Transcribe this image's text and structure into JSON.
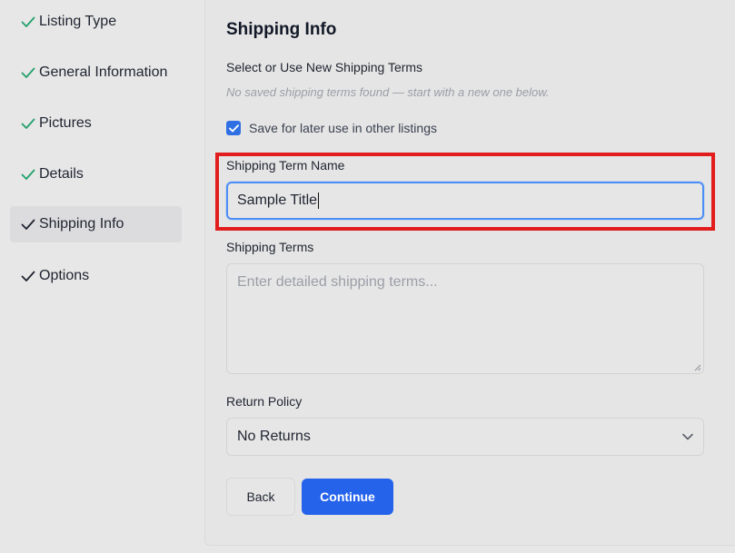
{
  "colors": {
    "accent": "#2563eb",
    "completed_check": "#22a06b",
    "highlight_box": "#e11d1d"
  },
  "sidebar": {
    "steps": [
      {
        "label": "Listing Type",
        "status": "completed",
        "icon": "check-icon"
      },
      {
        "label": "General Information",
        "status": "completed",
        "icon": "check-icon"
      },
      {
        "label": "Pictures",
        "status": "completed",
        "icon": "check-icon"
      },
      {
        "label": "Details",
        "status": "completed",
        "icon": "check-icon"
      },
      {
        "label": "Shipping Info",
        "status": "active",
        "icon": "check-icon"
      },
      {
        "label": "Options",
        "status": "pending",
        "icon": "check-icon"
      }
    ]
  },
  "form": {
    "title": "Shipping Info",
    "select_heading": "Select or Use New Shipping Terms",
    "empty_hint": "No saved shipping terms found — start with a new one below.",
    "save_checkbox": {
      "label": "Save for later use in other listings",
      "checked": true
    },
    "term_name": {
      "label": "Shipping Term Name",
      "value": "Sample Title"
    },
    "terms": {
      "label": "Shipping Terms",
      "placeholder": "Enter detailed shipping terms..."
    },
    "return_policy": {
      "label": "Return Policy",
      "selected": "No Returns"
    },
    "back_label": "Back",
    "continue_label": "Continue"
  }
}
